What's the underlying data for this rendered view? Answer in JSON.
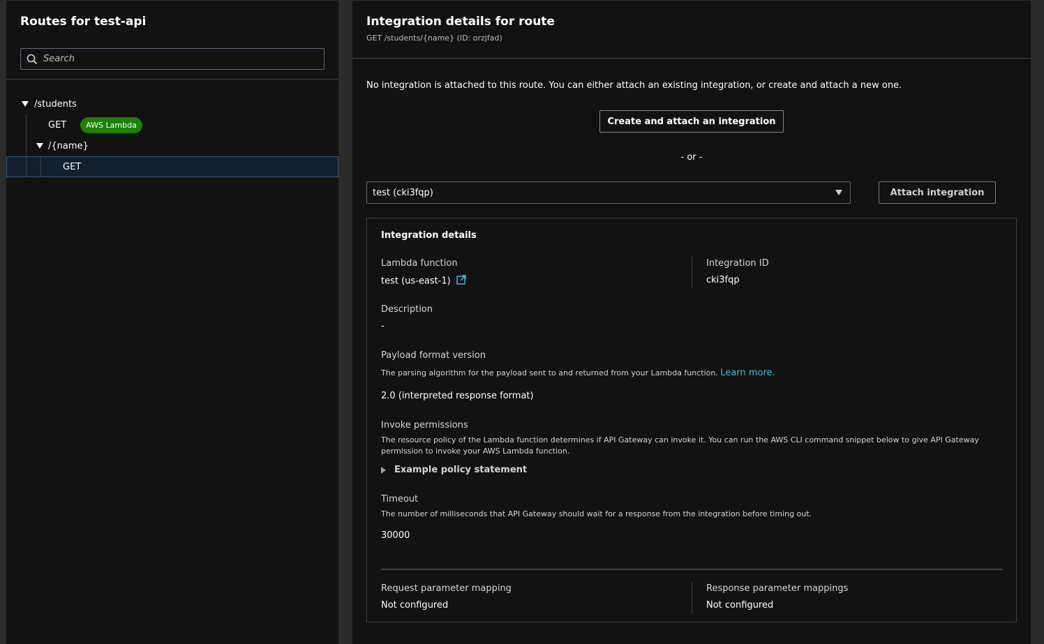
{
  "left_panel": {
    "title": "Routes for test-api",
    "search_placeholder": "Search",
    "tree": {
      "students_path": "/students",
      "students_get": "GET",
      "students_get_badge": "AWS Lambda",
      "name_path": "/{name}",
      "name_get": "GET"
    }
  },
  "right_panel": {
    "title": "Integration details for route",
    "subtitle": "GET /students/{name} (ID: orzjfad)",
    "message": "No integration is attached to this route. You can either attach an existing integration, or create and attach a new one.",
    "create_button": "Create and attach an integration",
    "or_text": "- or -",
    "select_value": "test (cki3fqp)",
    "attach_button": "Attach integration",
    "details": {
      "title": "Integration details",
      "lambda_label": "Lambda function",
      "lambda_value": "test (us-east-1)",
      "integration_id_label": "Integration ID",
      "integration_id_value": "cki3fqp",
      "description_label": "Description",
      "description_value": "-",
      "payload_label": "Payload format version",
      "payload_desc": "The parsing algorithm for the payload sent to and returned from your Lambda function.",
      "payload_learn_more": "Learn more.",
      "payload_value": "2.0 (interpreted response format)",
      "invoke_label": "Invoke permissions",
      "invoke_desc": "The resource policy of the Lambda function determines if API Gateway can invoke it. You can run the AWS CLI command snippet below to give API Gateway permission to invoke your AWS Lambda function.",
      "example_policy": "Example policy statement",
      "timeout_label": "Timeout",
      "timeout_desc": "The number of milliseconds that API Gateway should wait for a response from the integration before timing out.",
      "timeout_value": "30000",
      "request_mapping_label": "Request parameter mapping",
      "request_mapping_value": "Not configured",
      "response_mapping_label": "Response parameter mappings",
      "response_mapping_value": "Not configured"
    }
  },
  "icons": {
    "search": "search-icon",
    "external_link": "external-link-icon"
  },
  "colors": {
    "background": "#121212",
    "badge_green": "#1d8102",
    "link_blue": "#44b9d6",
    "selected_row": "#14202e"
  }
}
